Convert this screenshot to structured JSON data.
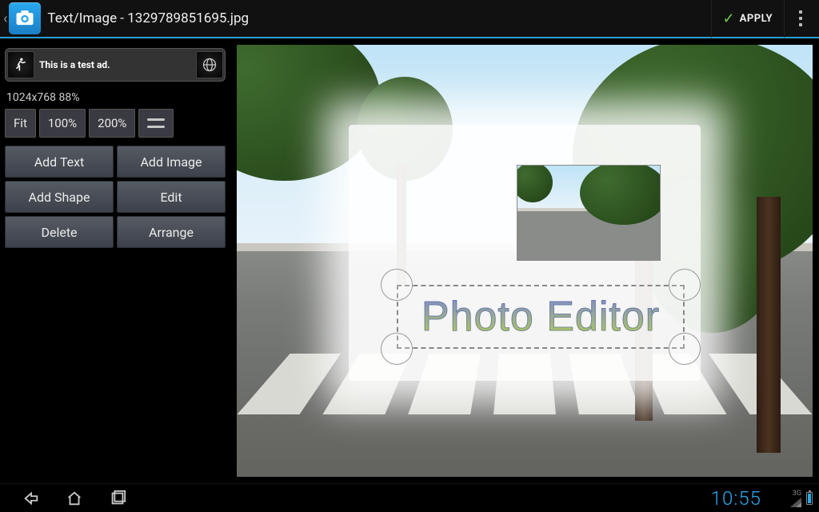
{
  "header": {
    "title": "Text/Image - 1329789851695.jpg",
    "apply_label": "APPLY"
  },
  "ad": {
    "text": "This is a test ad."
  },
  "image_info": {
    "dimensions": "1024x768",
    "zoom_percent": "88%"
  },
  "zoom": {
    "fit": "Fit",
    "p100": "100%",
    "p200": "200%"
  },
  "tools": {
    "add_text": "Add Text",
    "add_image": "Add Image",
    "add_shape": "Add Shape",
    "edit": "Edit",
    "delete": "Delete",
    "arrange": "Arrange"
  },
  "canvas": {
    "text_object": "Photo Editor"
  },
  "system": {
    "clock": "10:55",
    "signal_label": "3G"
  }
}
